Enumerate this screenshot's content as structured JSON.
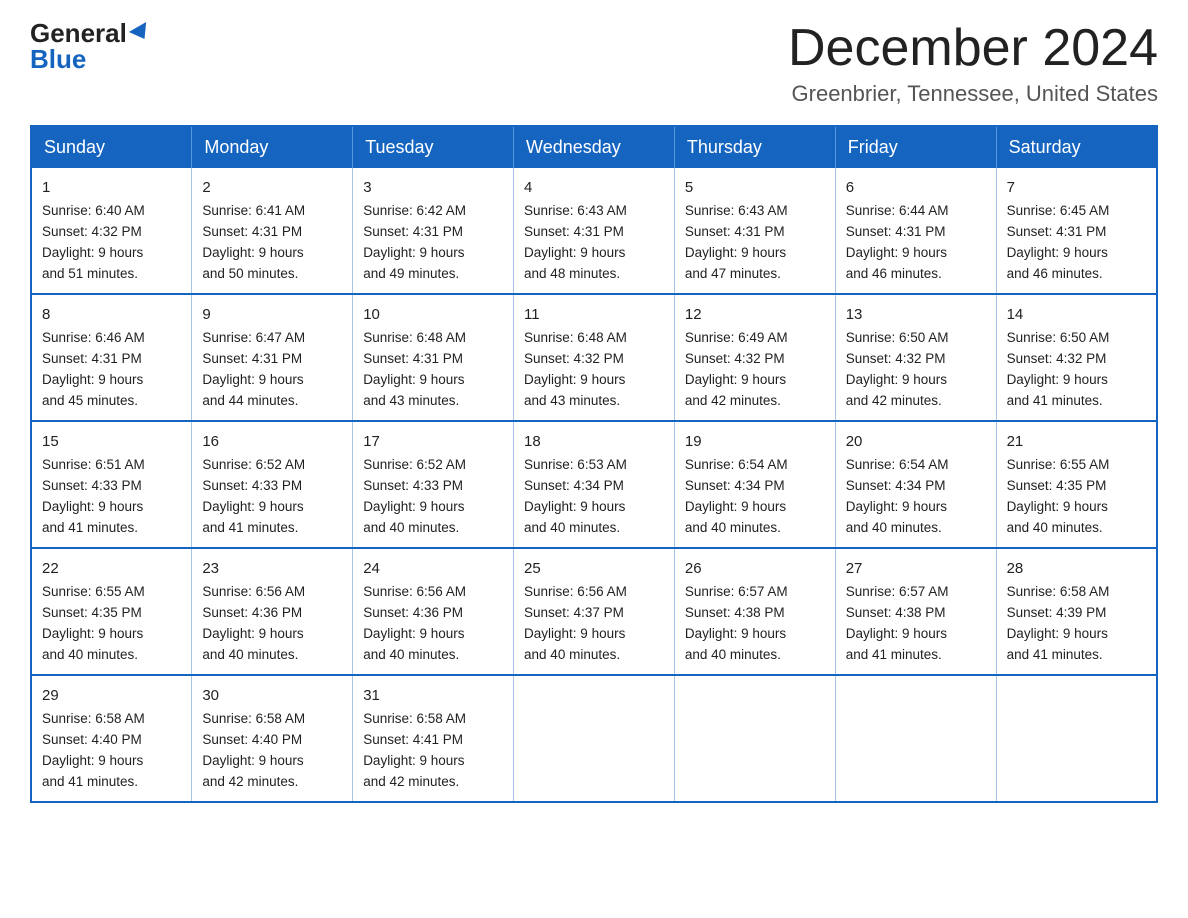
{
  "header": {
    "logo_general": "General",
    "logo_blue": "Blue",
    "month_title": "December 2024",
    "location": "Greenbrier, Tennessee, United States"
  },
  "weekdays": [
    "Sunday",
    "Monday",
    "Tuesday",
    "Wednesday",
    "Thursday",
    "Friday",
    "Saturday"
  ],
  "weeks": [
    [
      {
        "day": "1",
        "sunrise": "Sunrise: 6:40 AM",
        "sunset": "Sunset: 4:32 PM",
        "daylight": "Daylight: 9 hours",
        "daylight2": "and 51 minutes."
      },
      {
        "day": "2",
        "sunrise": "Sunrise: 6:41 AM",
        "sunset": "Sunset: 4:31 PM",
        "daylight": "Daylight: 9 hours",
        "daylight2": "and 50 minutes."
      },
      {
        "day": "3",
        "sunrise": "Sunrise: 6:42 AM",
        "sunset": "Sunset: 4:31 PM",
        "daylight": "Daylight: 9 hours",
        "daylight2": "and 49 minutes."
      },
      {
        "day": "4",
        "sunrise": "Sunrise: 6:43 AM",
        "sunset": "Sunset: 4:31 PM",
        "daylight": "Daylight: 9 hours",
        "daylight2": "and 48 minutes."
      },
      {
        "day": "5",
        "sunrise": "Sunrise: 6:43 AM",
        "sunset": "Sunset: 4:31 PM",
        "daylight": "Daylight: 9 hours",
        "daylight2": "and 47 minutes."
      },
      {
        "day": "6",
        "sunrise": "Sunrise: 6:44 AM",
        "sunset": "Sunset: 4:31 PM",
        "daylight": "Daylight: 9 hours",
        "daylight2": "and 46 minutes."
      },
      {
        "day": "7",
        "sunrise": "Sunrise: 6:45 AM",
        "sunset": "Sunset: 4:31 PM",
        "daylight": "Daylight: 9 hours",
        "daylight2": "and 46 minutes."
      }
    ],
    [
      {
        "day": "8",
        "sunrise": "Sunrise: 6:46 AM",
        "sunset": "Sunset: 4:31 PM",
        "daylight": "Daylight: 9 hours",
        "daylight2": "and 45 minutes."
      },
      {
        "day": "9",
        "sunrise": "Sunrise: 6:47 AM",
        "sunset": "Sunset: 4:31 PM",
        "daylight": "Daylight: 9 hours",
        "daylight2": "and 44 minutes."
      },
      {
        "day": "10",
        "sunrise": "Sunrise: 6:48 AM",
        "sunset": "Sunset: 4:31 PM",
        "daylight": "Daylight: 9 hours",
        "daylight2": "and 43 minutes."
      },
      {
        "day": "11",
        "sunrise": "Sunrise: 6:48 AM",
        "sunset": "Sunset: 4:32 PM",
        "daylight": "Daylight: 9 hours",
        "daylight2": "and 43 minutes."
      },
      {
        "day": "12",
        "sunrise": "Sunrise: 6:49 AM",
        "sunset": "Sunset: 4:32 PM",
        "daylight": "Daylight: 9 hours",
        "daylight2": "and 42 minutes."
      },
      {
        "day": "13",
        "sunrise": "Sunrise: 6:50 AM",
        "sunset": "Sunset: 4:32 PM",
        "daylight": "Daylight: 9 hours",
        "daylight2": "and 42 minutes."
      },
      {
        "day": "14",
        "sunrise": "Sunrise: 6:50 AM",
        "sunset": "Sunset: 4:32 PM",
        "daylight": "Daylight: 9 hours",
        "daylight2": "and 41 minutes."
      }
    ],
    [
      {
        "day": "15",
        "sunrise": "Sunrise: 6:51 AM",
        "sunset": "Sunset: 4:33 PM",
        "daylight": "Daylight: 9 hours",
        "daylight2": "and 41 minutes."
      },
      {
        "day": "16",
        "sunrise": "Sunrise: 6:52 AM",
        "sunset": "Sunset: 4:33 PM",
        "daylight": "Daylight: 9 hours",
        "daylight2": "and 41 minutes."
      },
      {
        "day": "17",
        "sunrise": "Sunrise: 6:52 AM",
        "sunset": "Sunset: 4:33 PM",
        "daylight": "Daylight: 9 hours",
        "daylight2": "and 40 minutes."
      },
      {
        "day": "18",
        "sunrise": "Sunrise: 6:53 AM",
        "sunset": "Sunset: 4:34 PM",
        "daylight": "Daylight: 9 hours",
        "daylight2": "and 40 minutes."
      },
      {
        "day": "19",
        "sunrise": "Sunrise: 6:54 AM",
        "sunset": "Sunset: 4:34 PM",
        "daylight": "Daylight: 9 hours",
        "daylight2": "and 40 minutes."
      },
      {
        "day": "20",
        "sunrise": "Sunrise: 6:54 AM",
        "sunset": "Sunset: 4:34 PM",
        "daylight": "Daylight: 9 hours",
        "daylight2": "and 40 minutes."
      },
      {
        "day": "21",
        "sunrise": "Sunrise: 6:55 AM",
        "sunset": "Sunset: 4:35 PM",
        "daylight": "Daylight: 9 hours",
        "daylight2": "and 40 minutes."
      }
    ],
    [
      {
        "day": "22",
        "sunrise": "Sunrise: 6:55 AM",
        "sunset": "Sunset: 4:35 PM",
        "daylight": "Daylight: 9 hours",
        "daylight2": "and 40 minutes."
      },
      {
        "day": "23",
        "sunrise": "Sunrise: 6:56 AM",
        "sunset": "Sunset: 4:36 PM",
        "daylight": "Daylight: 9 hours",
        "daylight2": "and 40 minutes."
      },
      {
        "day": "24",
        "sunrise": "Sunrise: 6:56 AM",
        "sunset": "Sunset: 4:36 PM",
        "daylight": "Daylight: 9 hours",
        "daylight2": "and 40 minutes."
      },
      {
        "day": "25",
        "sunrise": "Sunrise: 6:56 AM",
        "sunset": "Sunset: 4:37 PM",
        "daylight": "Daylight: 9 hours",
        "daylight2": "and 40 minutes."
      },
      {
        "day": "26",
        "sunrise": "Sunrise: 6:57 AM",
        "sunset": "Sunset: 4:38 PM",
        "daylight": "Daylight: 9 hours",
        "daylight2": "and 40 minutes."
      },
      {
        "day": "27",
        "sunrise": "Sunrise: 6:57 AM",
        "sunset": "Sunset: 4:38 PM",
        "daylight": "Daylight: 9 hours",
        "daylight2": "and 41 minutes."
      },
      {
        "day": "28",
        "sunrise": "Sunrise: 6:58 AM",
        "sunset": "Sunset: 4:39 PM",
        "daylight": "Daylight: 9 hours",
        "daylight2": "and 41 minutes."
      }
    ],
    [
      {
        "day": "29",
        "sunrise": "Sunrise: 6:58 AM",
        "sunset": "Sunset: 4:40 PM",
        "daylight": "Daylight: 9 hours",
        "daylight2": "and 41 minutes."
      },
      {
        "day": "30",
        "sunrise": "Sunrise: 6:58 AM",
        "sunset": "Sunset: 4:40 PM",
        "daylight": "Daylight: 9 hours",
        "daylight2": "and 42 minutes."
      },
      {
        "day": "31",
        "sunrise": "Sunrise: 6:58 AM",
        "sunset": "Sunset: 4:41 PM",
        "daylight": "Daylight: 9 hours",
        "daylight2": "and 42 minutes."
      },
      null,
      null,
      null,
      null
    ]
  ]
}
